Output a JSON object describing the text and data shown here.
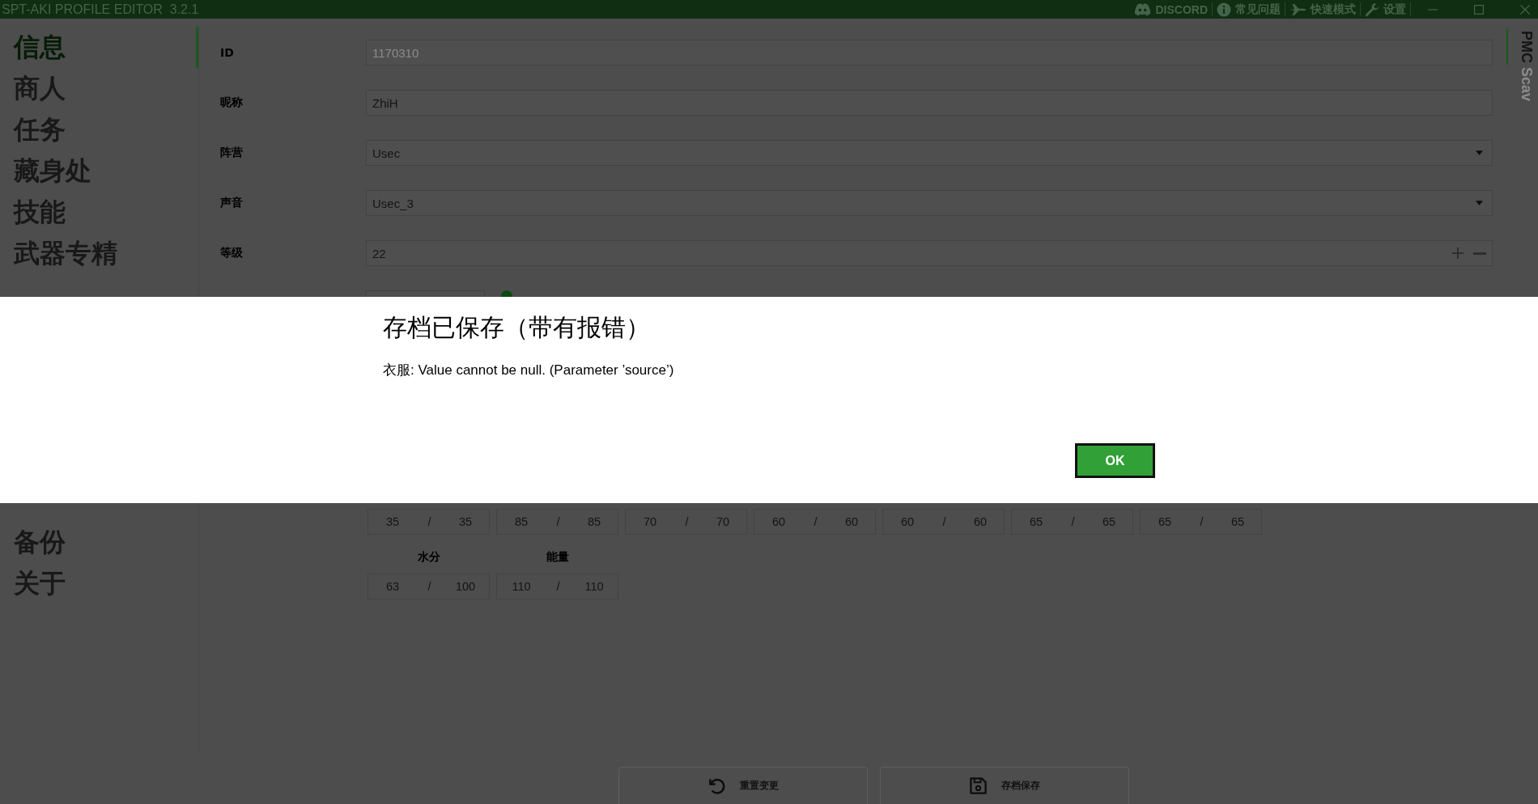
{
  "window": {
    "title": "SPT-AKI PROFILE EDITOR  3.2.1"
  },
  "toolbar": [
    {
      "kind": "discord",
      "label": "DISCORD"
    },
    {
      "kind": "faq",
      "label": "常见问题"
    },
    {
      "kind": "fast",
      "label": "快速模式"
    },
    {
      "kind": "settings",
      "label": "设置"
    }
  ],
  "sidebar": {
    "items": [
      {
        "label": "信息",
        "selected": true
      },
      {
        "label": "商人",
        "selected": false
      },
      {
        "label": "任务",
        "selected": false
      },
      {
        "label": "藏身处",
        "selected": false
      },
      {
        "label": "技能",
        "selected": false
      },
      {
        "label": "武器专精",
        "selected": false
      },
      {
        "label": "备份",
        "selected": false
      },
      {
        "label": "关于",
        "selected": false
      }
    ]
  },
  "profile_tabs": [
    {
      "label": "PMC",
      "selected": true
    },
    {
      "label": "Scav",
      "selected": false
    }
  ],
  "fields": [
    {
      "kind": "readonly",
      "label": "ID",
      "value": "1170310"
    },
    {
      "kind": "text",
      "label": "昵称",
      "value": "ZhiH"
    },
    {
      "kind": "dropdown",
      "label": "阵营",
      "value": "Usec"
    },
    {
      "kind": "dropdown",
      "label": "声音",
      "value": "Usec_3"
    },
    {
      "kind": "stepper",
      "label": "等级",
      "value": "22"
    }
  ],
  "dialog": {
    "title": "存档已保存（带有报错）",
    "message": "衣服: Value cannot be null. (Parameter ’source’)",
    "button": "OK"
  },
  "stats": [
    {
      "items": [
        {
          "current": "35",
          "separator": "/",
          "max": "35"
        },
        {
          "current": "85",
          "separator": "/",
          "max": "85"
        },
        {
          "current": "70",
          "separator": "/",
          "max": "70"
        },
        {
          "current": "60",
          "separator": "/",
          "max": "60"
        },
        {
          "current": "60",
          "separator": "/",
          "max": "60"
        },
        {
          "current": "65",
          "separator": "/",
          "max": "65"
        },
        {
          "current": "65",
          "separator": "/",
          "max": "65"
        }
      ]
    },
    {
      "items": [
        {
          "label": "水分",
          "current": "63",
          "separator": "/",
          "max": "100"
        },
        {
          "label": "能量",
          "current": "110",
          "separator": "/",
          "max": "110"
        }
      ]
    }
  ],
  "actions": [
    {
      "kind": "reset",
      "label": "重置变更"
    },
    {
      "kind": "save",
      "label": "存档保存"
    }
  ]
}
